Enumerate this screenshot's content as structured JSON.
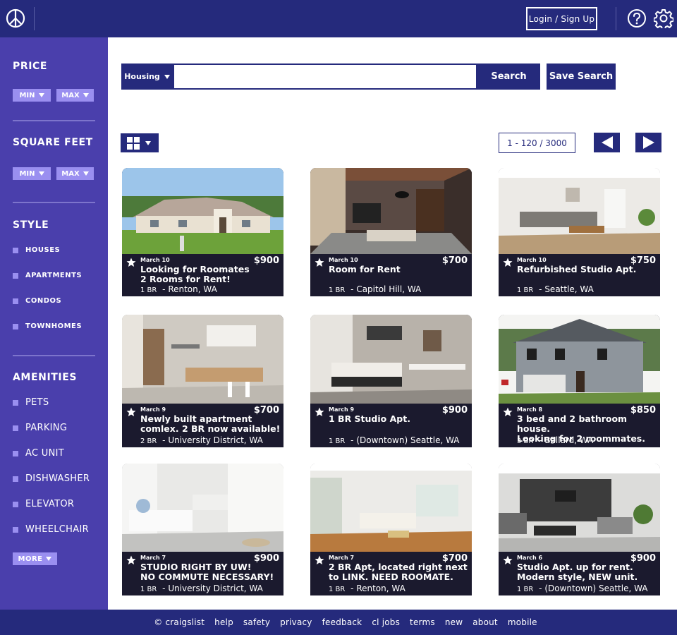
{
  "header": {
    "login_label": "Login / Sign Up"
  },
  "sidebar": {
    "price": {
      "heading": "PRICE",
      "min_label": "MIN",
      "max_label": "MAX"
    },
    "square_feet": {
      "heading": "SQUARE FEET",
      "min_label": "MIN",
      "max_label": "MAX"
    },
    "style": {
      "heading": "STYLE",
      "items": [
        "HOUSES",
        "APARTMENTS",
        "CONDOS",
        "TOWNHOMES"
      ]
    },
    "amenities": {
      "heading": "AMENITIES",
      "items": [
        "PETS",
        "PARKING",
        "AC UNIT",
        "DISHWASHER",
        "ELEVATOR",
        "WHEELCHAIR"
      ]
    },
    "more_label": "MORE"
  },
  "search": {
    "category": "Housing",
    "query": "",
    "search_label": "Search",
    "save_label": "Save Search"
  },
  "toolbar": {
    "pager_text": "1 - 120 / 3000"
  },
  "listings": [
    {
      "date": "March 10",
      "price": "$900",
      "title": "Looking for Roomates\n2 Rooms for Rent!",
      "br": "1 BR",
      "location": " - Renton, WA"
    },
    {
      "date": "March 10",
      "price": "$700",
      "title": "Room for Rent",
      "br": "1 BR",
      "location": " - Capitol Hill, WA"
    },
    {
      "date": "March 10",
      "price": "$750",
      "title": "Refurbished Studio Apt.",
      "br": "1 BR",
      "location": " - Seattle, WA"
    },
    {
      "date": "March 9",
      "price": "$700",
      "title": "Newly built apartment\ncomlex. 2 BR now available!",
      "br": "2 BR",
      "location": " - University District, WA"
    },
    {
      "date": "March 9",
      "price": "$900",
      "title": "1 BR Studio Apt.",
      "br": "1 BR",
      "location": " - (Downtown) Seattle, WA"
    },
    {
      "date": "March 8",
      "price": "$850",
      "title": "3 bed and 2 bathroom house.\nLooking for 2 roommates.",
      "br": "3 BR",
      "location": " - Ballard, WA"
    },
    {
      "date": "March 7",
      "price": "$900",
      "title": "STUDIO RIGHT BY UW!\nNO COMMUTE NECESSARY!",
      "br": "1 BR",
      "location": " - University District, WA"
    },
    {
      "date": "March 7",
      "price": "$700",
      "title": "2 BR Apt, located right next\nto LINK. NEED ROOMATE.",
      "br": "1 BR",
      "location": " - Renton, WA"
    },
    {
      "date": "March 6",
      "price": "$900",
      "title": "Studio Apt. up for rent.\nModern style, NEW unit.",
      "br": "1 BR",
      "location": " - (Downtown) Seattle, WA"
    }
  ],
  "footer": {
    "links": [
      "© craigslist",
      "help",
      "safety",
      "privacy",
      "feedback",
      "cl jobs",
      "terms",
      "new",
      "about",
      "mobile"
    ]
  }
}
